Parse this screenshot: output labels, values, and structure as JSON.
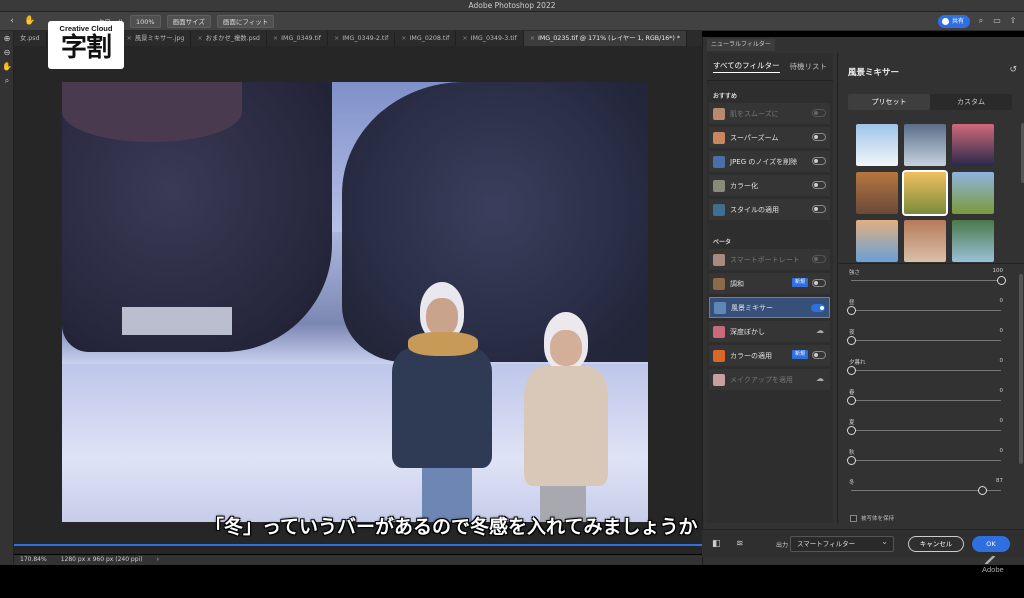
{
  "app_title": "Adobe Photoshop 2022",
  "options_bar": {
    "scroll_all_label": "クロール",
    "zoom_label": "100%",
    "fit_screen_label": "画面サイズ",
    "fill_screen_label": "画面にフィット",
    "share_label": "共有"
  },
  "tabs": [
    {
      "label": "女.psd"
    },
    {
      "label": "風景ミキサー.jpg"
    },
    {
      "label": "おまかせ_複数.psd"
    },
    {
      "label": "IMG_0349.tif"
    },
    {
      "label": "IMG_0349-2.tif"
    },
    {
      "label": "IMG_0208.tif"
    },
    {
      "label": "IMG_0349-3.tif"
    },
    {
      "label": "IMG_0235.tif @ 171% (レイヤー 1, RGB/16*) *"
    }
  ],
  "logo": {
    "top": "Creative Cloud",
    "main": "字割"
  },
  "caption": "「冬」っていうバーがあるので冬感を入れてみましょうか",
  "status": {
    "zoom": "170.84%",
    "doc_size": "1280 px x 960 px (240 ppi)"
  },
  "neural_panel": {
    "panel_tab": "ニューラルフィルター",
    "tabs": {
      "all": "すべてのフィルター",
      "waitlist": "待機リスト"
    },
    "featured_label": "おすすめ",
    "beta_label": "ベータ",
    "featured": [
      {
        "name": "肌をスムーズに",
        "dim": true,
        "color": "#b98a6e"
      },
      {
        "name": "スーパーズーム",
        "dim": false,
        "color": "#c9875f"
      },
      {
        "name": "JPEG のノイズを削除",
        "dim": false,
        "color": "#4b6fa8"
      },
      {
        "name": "カラー化",
        "dim": false,
        "color": "#8a8a7a"
      },
      {
        "name": "スタイルの適用",
        "dim": false,
        "color": "#3f6f8f"
      }
    ],
    "beta": [
      {
        "name": "スマートポートレート",
        "dim": true,
        "color": "#a98a80",
        "control": "toggle-dim"
      },
      {
        "name": "調和",
        "dim": false,
        "color": "#8a6a4a",
        "badge": "新規",
        "control": "toggle"
      },
      {
        "name": "風景ミキサー",
        "dim": false,
        "color": "#5d88b8",
        "control": "toggle-on",
        "selected": true
      },
      {
        "name": "深度ぼかし",
        "dim": false,
        "color": "#c86a7a",
        "control": "cloud"
      },
      {
        "name": "カラーの適用",
        "dim": false,
        "color": "#d8682a",
        "badge": "新規",
        "control": "toggle"
      },
      {
        "name": "メイクアップを適用",
        "dim": true,
        "color": "#c9a0a0",
        "control": "cloud"
      }
    ],
    "mixer_title": "風景ミキサー",
    "segments": {
      "preset": "プリセット",
      "custom": "カスタム"
    },
    "presets": [
      {
        "color_a": "#9ec4e8",
        "color_b": "#f2f6fb"
      },
      {
        "color_a": "#5a6e8a",
        "color_b": "#c7d2de"
      },
      {
        "color_a": "#d06a7a",
        "color_b": "#2a2a4a"
      },
      {
        "color_a": "#b7763f",
        "color_b": "#6a4a3a"
      },
      {
        "color_a": "#f0c060",
        "color_b": "#7a8a3a",
        "selected": true
      },
      {
        "color_a": "#8fb4e0",
        "color_b": "#7a9a3a"
      },
      {
        "color_a": "#e0b080",
        "color_b": "#6aa0d8"
      },
      {
        "color_a": "#b77a5a",
        "color_b": "#d8c0a8"
      },
      {
        "color_a": "#4a7a4a",
        "color_b": "#9ac0d8"
      }
    ],
    "sliders": [
      {
        "label": "強さ",
        "value": "100",
        "fraction": 1.0
      },
      {
        "label": "昼",
        "value": "0",
        "fraction": 0.0
      },
      {
        "label": "夜",
        "value": "0",
        "fraction": 0.0
      },
      {
        "label": "夕暮れ",
        "value": "0",
        "fraction": 0.0
      },
      {
        "label": "春",
        "value": "0",
        "fraction": 0.0
      },
      {
        "label": "夏",
        "value": "0",
        "fraction": 0.0
      },
      {
        "label": "秋",
        "value": "0",
        "fraction": 0.0
      },
      {
        "label": "冬",
        "value": "87",
        "fraction": 0.87
      }
    ],
    "preserve_subject": "被写体を保持",
    "output_label": "出力",
    "output_value": "スマートフィルター",
    "cancel": "キャンセル",
    "ok": "OK"
  },
  "adobe_mark": "Adobe"
}
